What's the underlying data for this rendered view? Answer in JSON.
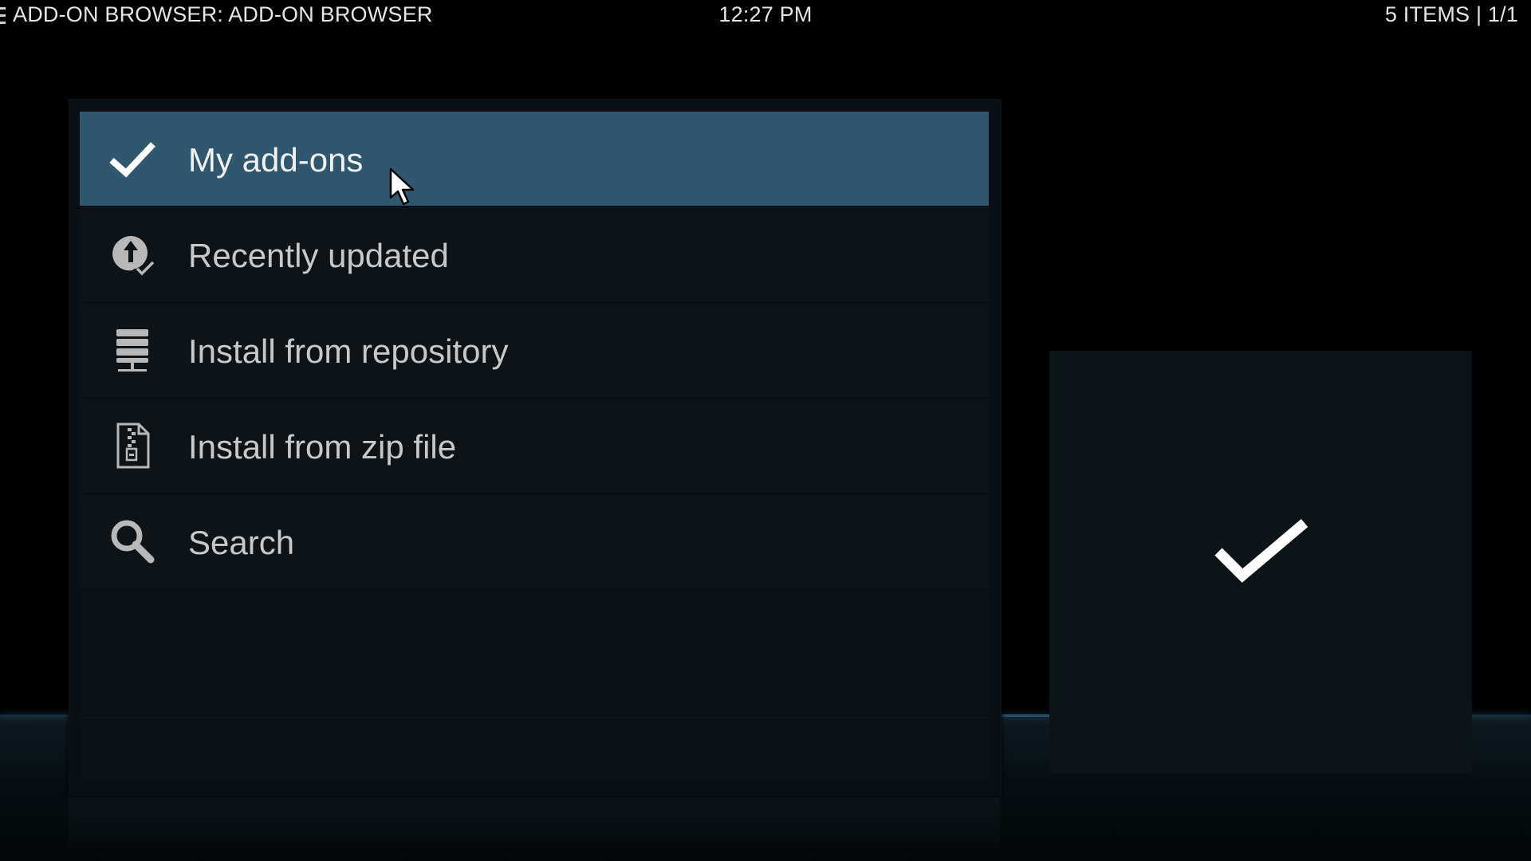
{
  "header": {
    "breadcrumb": "ADD-ON BROWSER: ADD-ON BROWSER",
    "clock": "12:27 PM",
    "counter": "5 ITEMS | 1/1"
  },
  "menu": {
    "items": [
      {
        "label": "My add-ons",
        "icon": "checkmark-icon",
        "focused": true
      },
      {
        "label": "Recently updated",
        "icon": "update-check-icon",
        "focused": false
      },
      {
        "label": "Install from repository",
        "icon": "repository-server-icon",
        "focused": false
      },
      {
        "label": "Install from zip file",
        "icon": "zip-file-icon",
        "focused": false
      },
      {
        "label": "Search",
        "icon": "magnifier-icon",
        "focused": false
      }
    ]
  },
  "preview": {
    "icon": "checkmark-icon"
  },
  "colors": {
    "focus": "#30576e",
    "panel": "#0a0f13",
    "text": "#c8c8c8"
  }
}
